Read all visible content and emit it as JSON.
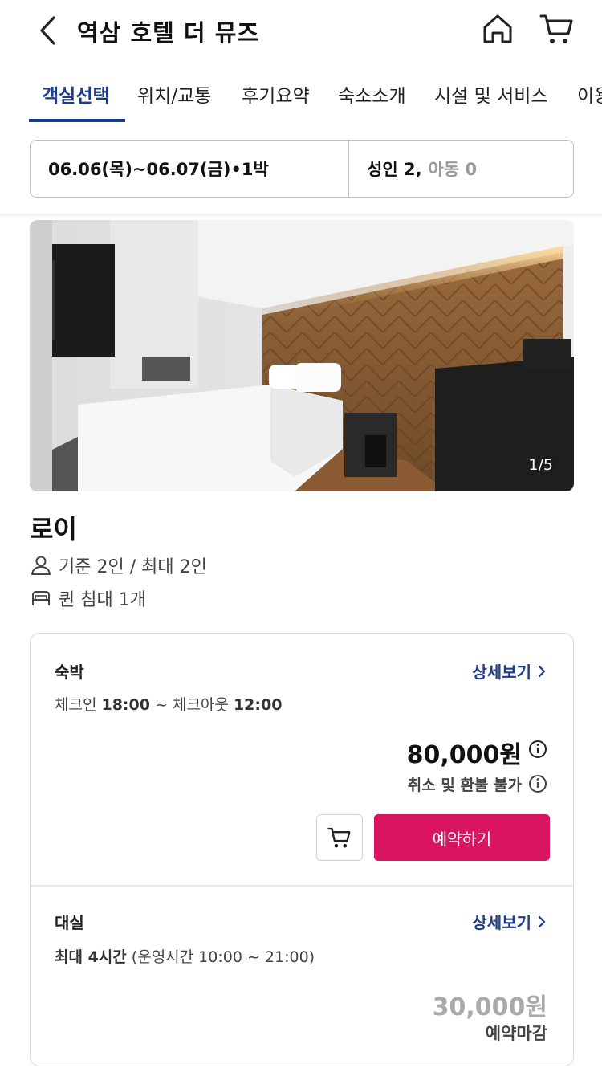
{
  "header": {
    "title": "역삼 호텔 더 뮤즈"
  },
  "tabs": [
    {
      "label": "객실선택",
      "active": true
    },
    {
      "label": "위치/교통"
    },
    {
      "label": "후기요약"
    },
    {
      "label": "숙소소개"
    },
    {
      "label": "시설 및 서비스"
    },
    {
      "label": "이용"
    }
  ],
  "search": {
    "dates": "06.06(목)~06.07(금)•1박",
    "adults": "성인 2,",
    "children": "아동 0"
  },
  "photo": {
    "counter": "1/5"
  },
  "room": {
    "name": "로이",
    "capacity": "기준 2인 / 최대 2인",
    "bed": "퀸 침대 1개"
  },
  "plans": {
    "stay": {
      "label": "숙박",
      "detail": "상세보기",
      "time_prefix": "체크인 ",
      "checkin": "18:00",
      "time_mid": " ~ 체크아웃 ",
      "checkout": "12:00",
      "price": "80,000원",
      "refund": "취소 및 환불 불가",
      "reserve": "예약하기"
    },
    "dayuse": {
      "label": "대실",
      "detail": "상세보기",
      "max_hours": "최대 4시간",
      "hours_note": " (운영시간 10:00 ~ 21:00)",
      "price": "30,000원",
      "status": "예약마감"
    }
  },
  "colors": {
    "accent": "#1c3d8f",
    "reserve": "#d91461"
  }
}
